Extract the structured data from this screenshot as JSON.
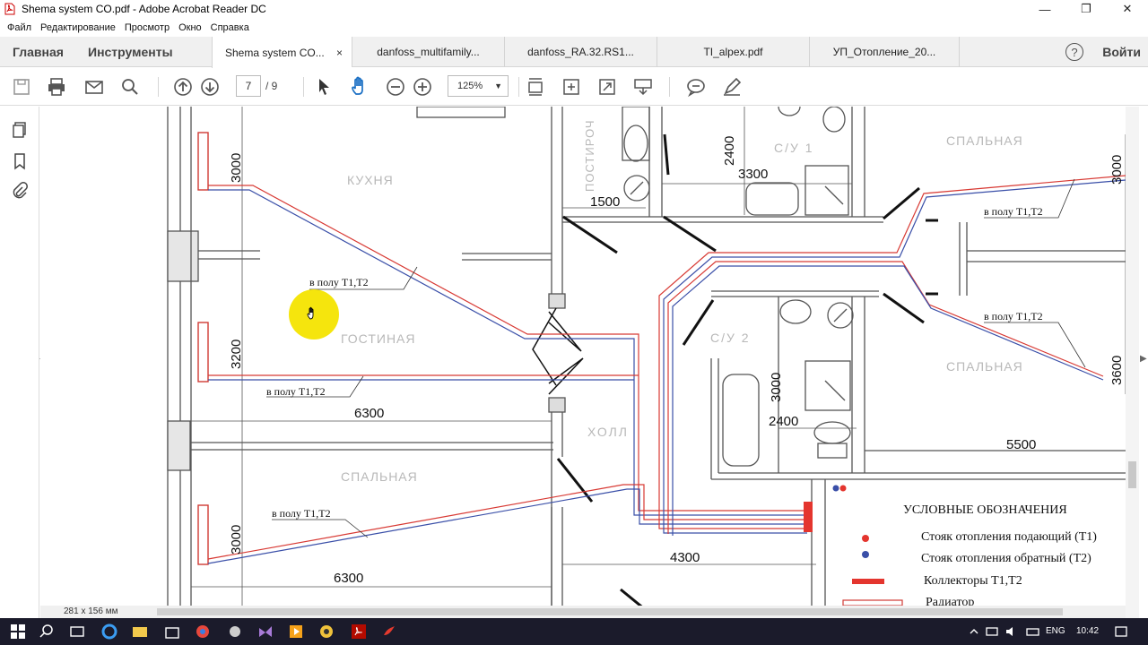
{
  "window": {
    "title": "Shema system CO.pdf - Adobe Acrobat Reader DC",
    "controls": [
      "—",
      "❐",
      "✕"
    ]
  },
  "menu": [
    "Файл",
    "Редактирование",
    "Просмотр",
    "Окно",
    "Справка"
  ],
  "nav_tabs": [
    "Главная",
    "Инструменты"
  ],
  "doc_tabs": [
    {
      "label": "Shema system CO...",
      "active": true,
      "close": "×"
    },
    {
      "label": "danfoss_multifamily..."
    },
    {
      "label": "danfoss_RA.32.RS1..."
    },
    {
      "label": "TI_alpex.pdf"
    },
    {
      "label": "УП_Отопление_20..."
    }
  ],
  "help_label": "?",
  "login_label": "Войти",
  "toolbar": {
    "page_current": "7",
    "page_total": "/ 9",
    "zoom": "125%"
  },
  "status": {
    "page_dims": "281 x 156 мм"
  },
  "drawing": {
    "rooms": {
      "kitchen": "КУХНЯ",
      "living": "ГОСТИНАЯ",
      "bedroom_left": "СПАЛЬНАЯ",
      "hall": "ХОЛЛ",
      "storage": "ПОСТИРОЧ",
      "bath1": "С/У 1",
      "bath2": "С/У 2",
      "bedroom_tr": "СПАЛЬНАЯ",
      "bedroom_r": "СПАЛЬНАЯ"
    },
    "dimensions": {
      "d3000_a": "3000",
      "d3200": "3200",
      "d3000_b": "3000",
      "d6300_a": "6300",
      "d6300_b": "6300",
      "d1500": "1500",
      "d2400_a": "2400",
      "d3300": "3300",
      "d3000_c": "3000",
      "d2400_b": "2400",
      "d4300": "4300",
      "d5500": "5500",
      "d3000_r": "3000",
      "d3600": "3600"
    },
    "pipe_label": "в полу Т1,Т2",
    "legend": {
      "title": "УСЛОВНЫЕ ОБОЗНАЧЕНИЯ",
      "items": [
        "Стояк отопления подающий (Т1)",
        "Стояк отопления обратный (Т2)",
        "Коллекторы Т1,Т2",
        "Радиатор"
      ],
      "colors": {
        "supply": "#e0302a",
        "return": "#3a4fa8"
      }
    }
  },
  "taskbar": {
    "lang": "ENG",
    "time": "10:42"
  }
}
